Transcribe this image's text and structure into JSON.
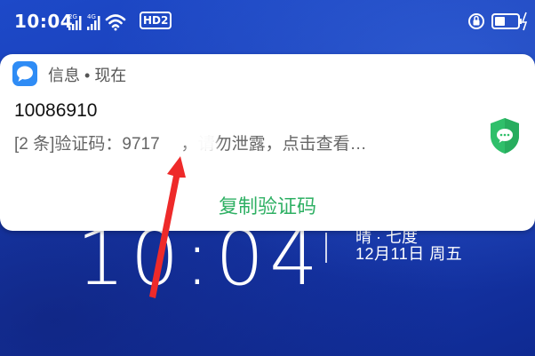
{
  "status_bar": {
    "time": "10:04",
    "signal_1_tag": "2G",
    "signal_2_tag": "4G",
    "hd_badge": "HD2"
  },
  "notification": {
    "app_name": "信息",
    "separator": " • ",
    "when": "现在",
    "sender": "10086910",
    "preview_prefix": "[2 条]验证码：9717",
    "preview_suffix": "，请勿泄露，点击查看…",
    "action_label": "复制验证码",
    "accent_color": "#2fb064"
  },
  "lockscreen": {
    "clock": "10:04",
    "weather": "晴 · 七度",
    "date": "12月11日  周五"
  }
}
